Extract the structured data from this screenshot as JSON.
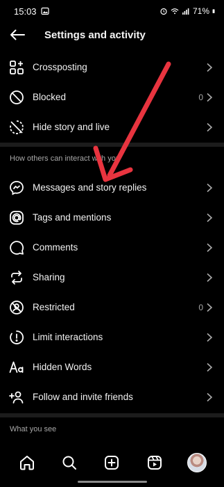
{
  "status_bar": {
    "time": "15:03",
    "battery": "71%"
  },
  "header": {
    "title": "Settings and activity"
  },
  "top_items": [
    {
      "label": "Crossposting",
      "icon": "crossposting-icon",
      "count": ""
    },
    {
      "label": "Blocked",
      "icon": "blocked-icon",
      "count": "0"
    },
    {
      "label": "Hide story and live",
      "icon": "hide-story-icon",
      "count": ""
    }
  ],
  "section_interact": {
    "header": "How others can interact with you",
    "items": [
      {
        "label": "Messages and story replies",
        "icon": "messenger-icon",
        "count": ""
      },
      {
        "label": "Tags and mentions",
        "icon": "at-icon",
        "count": ""
      },
      {
        "label": "Comments",
        "icon": "comment-icon",
        "count": ""
      },
      {
        "label": "Sharing",
        "icon": "share-repost-icon",
        "count": ""
      },
      {
        "label": "Restricted",
        "icon": "restricted-icon",
        "count": "0"
      },
      {
        "label": "Limit interactions",
        "icon": "limit-icon",
        "count": ""
      },
      {
        "label": "Hidden Words",
        "icon": "text-aa-icon",
        "count": ""
      },
      {
        "label": "Follow and invite friends",
        "icon": "add-person-icon",
        "count": ""
      }
    ]
  },
  "section_see": {
    "header": "What you see"
  },
  "bottom_nav": [
    "home-icon",
    "search-icon",
    "create-icon",
    "reels-icon",
    "profile-avatar"
  ],
  "colors": {
    "background": "#000000",
    "text": "#f5f5f5",
    "secondary_text": "#a8a8a8",
    "divider": "#1c1c1c",
    "annotation_arrow": "#e8343f"
  }
}
